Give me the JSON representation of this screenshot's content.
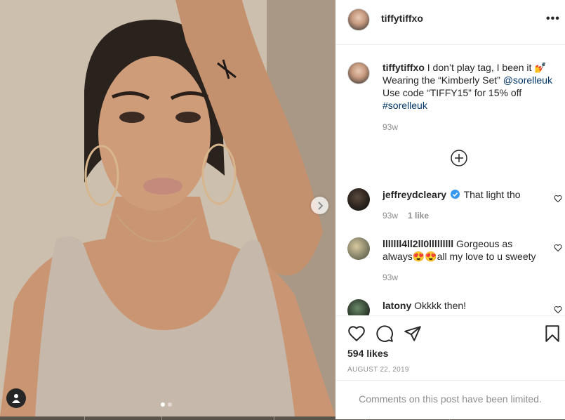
{
  "post": {
    "username": "tiffytiffxo",
    "more_label": "•••",
    "caption": {
      "username": "tiffytiffxo",
      "line1": "I don’t play tag, I been it 💅",
      "line2_prefix": "Wearing the “Kimberly Set” ",
      "mention": "@sorelleuk",
      "line3": "Use code “TIFFY15” for 15% off",
      "hashtag": "#sorelleuk",
      "age": "93w"
    }
  },
  "comments": [
    {
      "username": "jeffreydcleary",
      "verified": true,
      "text": "That light tho",
      "age": "93w",
      "likes": "1 like"
    },
    {
      "username": "lllllll4ll2ll0lllllllll",
      "text": "Gorgeous as always😍😍all my love to u sweety",
      "age": "93w"
    },
    {
      "username": "latony",
      "text": "Okkkk then!"
    }
  ],
  "actions": {
    "likes": "594 likes",
    "date": "AUGUST 22, 2019",
    "comments_limited": "Comments on this post have been limited."
  },
  "media": {
    "slide_count": 2,
    "active_slide": 1
  },
  "colors": {
    "text": "#262626",
    "secondary": "#8e8e8e",
    "link": "#00376b",
    "verified": "#3897f0",
    "border": "#efefef"
  }
}
